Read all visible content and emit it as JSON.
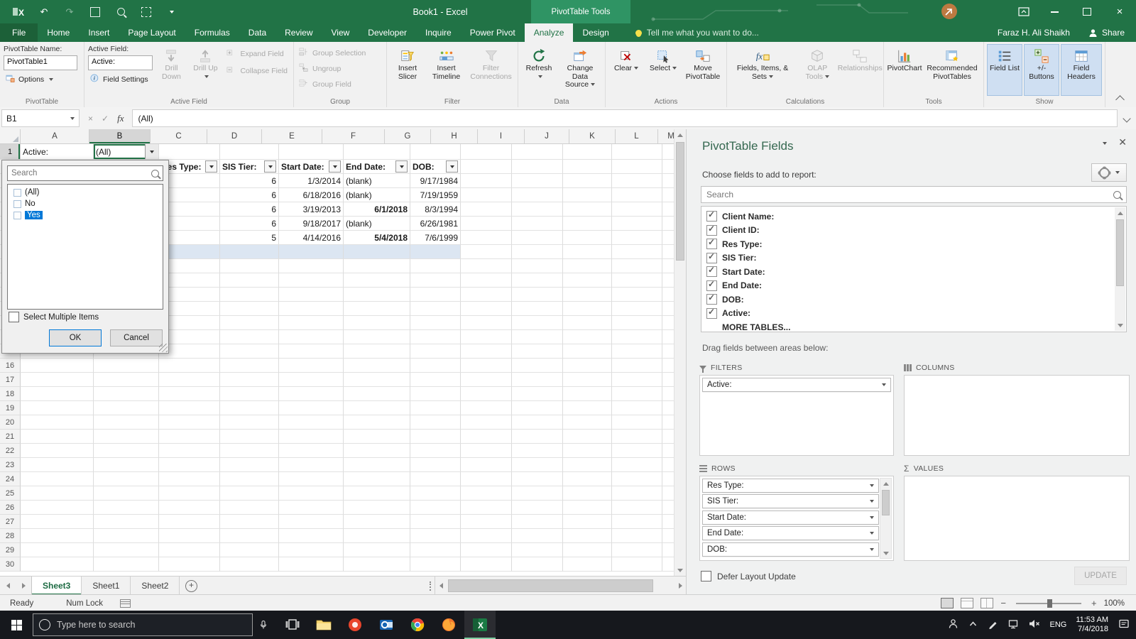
{
  "colors": {
    "excel_green": "#217346",
    "context_green": "#2f9464",
    "selection_blue": "#0078d7",
    "row_fill_blue": "#dce6f2",
    "toggle_fill": "#cfdff2",
    "taskbar_dark": "#16181d"
  },
  "title_bar": {
    "title": "Book1 - Excel",
    "context_label": "PivotTable Tools"
  },
  "ribbon": {
    "tabs": [
      {
        "label": "File",
        "file": true
      },
      {
        "label": "Home"
      },
      {
        "label": "Insert"
      },
      {
        "label": "Page Layout"
      },
      {
        "label": "Formulas"
      },
      {
        "label": "Data"
      },
      {
        "label": "Review"
      },
      {
        "label": "View"
      },
      {
        "label": "Developer"
      },
      {
        "label": "Inquire"
      },
      {
        "label": "Power Pivot"
      },
      {
        "label": "Analyze",
        "active": true
      },
      {
        "label": "Design"
      }
    ],
    "tell_me": "Tell me what you want to do...",
    "user_name": "Faraz H. Ali Shaikh",
    "share_label": "Share",
    "groups": [
      {
        "kind": "pivot",
        "group_label": "PivotTable",
        "name_label": "PivotTable Name:",
        "name_value": "PivotTable1",
        "options_label": "Options"
      },
      {
        "kind": "activefield",
        "group_label": "Active Field",
        "field_label": "Active Field:",
        "field_value": "Active:",
        "settings_label": "Field Settings",
        "drill_down": "Drill Down",
        "drill_up": "Drill Up",
        "expand_label": "Expand Field",
        "collapse_label": "Collapse Field"
      },
      {
        "kind": "smallstack",
        "group_label": "Group",
        "items": [
          {
            "label": "Group Selection",
            "icon": "group-selection",
            "disabled": true
          },
          {
            "label": "Ungroup",
            "icon": "ungroup",
            "disabled": true
          },
          {
            "label": "Group Field",
            "icon": "group-field",
            "disabled": true
          }
        ]
      },
      {
        "kind": "big",
        "group_label": "Filter",
        "buttons": [
          {
            "label": "Insert Slicer",
            "icon": "slicer"
          },
          {
            "label": "Insert Timeline",
            "icon": "timeline"
          },
          {
            "label": "Filter Connections",
            "icon": "filter-connections",
            "disabled": true
          }
        ]
      },
      {
        "kind": "big",
        "group_label": "Data",
        "buttons": [
          {
            "label": "Refresh",
            "icon": "refresh",
            "arrow": true
          },
          {
            "label": "Change Data Source",
            "icon": "change-data-source",
            "arrow": true
          }
        ]
      },
      {
        "kind": "big",
        "group_label": "Actions",
        "buttons": [
          {
            "label": "Clear",
            "icon": "clear",
            "arrow": true
          },
          {
            "label": "Select",
            "icon": "select",
            "arrow": true
          },
          {
            "label": "Move PivotTable",
            "icon": "move-pivottable"
          }
        ]
      },
      {
        "kind": "big",
        "group_label": "Calculations",
        "buttons": [
          {
            "label": "Fields, Items, & Sets",
            "icon": "fields-items-sets",
            "arrow": true
          },
          {
            "label": "OLAP Tools",
            "icon": "olap-tools",
            "arrow": true,
            "disabled": true
          },
          {
            "label": "Relationships",
            "icon": "relationships",
            "disabled": true
          }
        ]
      },
      {
        "kind": "big",
        "group_label": "Tools",
        "buttons": [
          {
            "label": "PivotChart",
            "icon": "pivotchart"
          },
          {
            "label": "Recommended PivotTables",
            "icon": "recommended-pivottables"
          }
        ]
      },
      {
        "kind": "big",
        "group_label": "Show",
        "buttons": [
          {
            "label": "Field List",
            "icon": "field-list",
            "active": true
          },
          {
            "label": "+/- Buttons",
            "icon": "plus-minus-buttons",
            "active": true
          },
          {
            "label": "Field Headers",
            "icon": "field-headers",
            "active": true
          }
        ]
      }
    ]
  },
  "formula_bar": {
    "name_box": "B1",
    "fx_label": "fx",
    "formula": "(All)"
  },
  "grid": {
    "columns": [
      "A",
      "B",
      "C",
      "D",
      "E",
      "F",
      "G",
      "H",
      "I",
      "J",
      "K",
      "L",
      "M"
    ],
    "row_count": 30,
    "selected_column": "B",
    "selected_row": 1,
    "fill_row": 8,
    "fill_cols": [
      "A",
      "B",
      "C",
      "D",
      "E",
      "F",
      "G"
    ],
    "cells": [
      {
        "ref": "A1",
        "text": "Active:"
      },
      {
        "ref": "B1",
        "text": "(All)",
        "selected": true,
        "dropdown": true
      },
      {
        "ref": "C2",
        "text": "Res Type:",
        "bold": true,
        "filter": true
      },
      {
        "ref": "D2",
        "text": "SIS Tier:",
        "bold": true,
        "filter": true
      },
      {
        "ref": "E2",
        "text": "Start Date:",
        "bold": true,
        "filter": true
      },
      {
        "ref": "F2",
        "text": "End Date:",
        "bold": true,
        "filter": true
      },
      {
        "ref": "G2",
        "text": "DOB:",
        "bold": true,
        "filter": true
      },
      {
        "ref": "D3",
        "text": "6",
        "align": "right"
      },
      {
        "ref": "E3",
        "text": "1/3/2014",
        "align": "right"
      },
      {
        "ref": "F3",
        "text": "(blank)"
      },
      {
        "ref": "G3",
        "text": "9/17/1984",
        "align": "right"
      },
      {
        "ref": "D4",
        "text": "6",
        "align": "right"
      },
      {
        "ref": "E4",
        "text": "6/18/2016",
        "align": "right"
      },
      {
        "ref": "F4",
        "text": "(blank)"
      },
      {
        "ref": "G4",
        "text": "7/19/1959",
        "align": "right"
      },
      {
        "ref": "D5",
        "text": "6",
        "align": "right"
      },
      {
        "ref": "E5",
        "text": "3/19/2013",
        "align": "right"
      },
      {
        "ref": "F5",
        "text": "6/1/2018",
        "align": "right",
        "bold": true
      },
      {
        "ref": "G5",
        "text": "8/3/1994",
        "align": "right"
      },
      {
        "ref": "D6",
        "text": "6",
        "align": "right"
      },
      {
        "ref": "E6",
        "text": "9/18/2017",
        "align": "right"
      },
      {
        "ref": "F6",
        "text": "(blank)"
      },
      {
        "ref": "G6",
        "text": "6/26/1981",
        "align": "right"
      },
      {
        "ref": "D7",
        "text": "5",
        "align": "right"
      },
      {
        "ref": "E7",
        "text": "4/14/2016",
        "align": "right"
      },
      {
        "ref": "F7",
        "text": "5/4/2018",
        "align": "right",
        "bold": true
      },
      {
        "ref": "G7",
        "text": "7/6/1999",
        "align": "right"
      }
    ]
  },
  "filter_popup": {
    "search_placeholder": "Search",
    "items": [
      {
        "label": "(All)"
      },
      {
        "label": "No"
      },
      {
        "label": "Yes",
        "selected": true
      }
    ],
    "multi_label": "Select Multiple Items",
    "ok_label": "OK",
    "cancel_label": "Cancel"
  },
  "fields_pane": {
    "title": "PivotTable Fields",
    "choose_label": "Choose fields to add to report:",
    "search_placeholder": "Search",
    "fields": [
      "Client Name:",
      "Client ID:",
      "Res Type:",
      "SIS Tier:",
      "Start Date:",
      "End Date:",
      "DOB:",
      "Active:"
    ],
    "more_tables": "MORE TABLES...",
    "drag_label": "Drag fields between areas below:",
    "areas": {
      "filters": {
        "label": "FILTERS",
        "items": [
          "Active:"
        ]
      },
      "columns": {
        "label": "COLUMNS",
        "items": []
      },
      "rows": {
        "label": "ROWS",
        "items": [
          "Res Type:",
          "SIS Tier:",
          "Start Date:",
          "End Date:",
          "DOB:"
        ]
      },
      "values": {
        "label": "VALUES",
        "items": []
      }
    },
    "defer_label": "Defer Layout Update",
    "update_label": "UPDATE"
  },
  "sheet_tabs": {
    "tabs": [
      {
        "label": "Sheet3",
        "active": true
      },
      {
        "label": "Sheet1"
      },
      {
        "label": "Sheet2"
      }
    ]
  },
  "status_bar": {
    "ready_label": "Ready",
    "numlock_label": "Num Lock",
    "zoom_value": "100%"
  },
  "taskbar": {
    "search_placeholder": "Type here to search",
    "apps": [
      {
        "name": "task-view"
      },
      {
        "name": "file-explorer"
      },
      {
        "name": "red-browser"
      },
      {
        "name": "outlook"
      },
      {
        "name": "chrome"
      },
      {
        "name": "firefox"
      },
      {
        "name": "excel",
        "active": true
      }
    ],
    "tray_icons": [
      "people",
      "chevron-up",
      "pen",
      "network",
      "volume"
    ],
    "language": "ENG",
    "time": "11:53 AM",
    "date": "7/4/2018"
  }
}
